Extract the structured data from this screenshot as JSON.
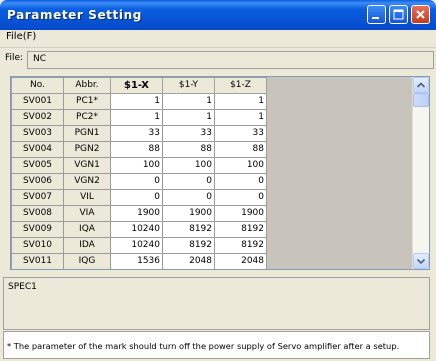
{
  "window": {
    "title": "Parameter Setting"
  },
  "menu": {
    "file_label": "File(F)"
  },
  "file": {
    "label": "File:",
    "value": "NC"
  },
  "grid": {
    "headers": [
      "No.",
      "Abbr.",
      "$1-X",
      "$1-Y",
      "$1-Z"
    ],
    "rows": [
      [
        "SV001",
        "PC1*",
        "1",
        "1",
        "1"
      ],
      [
        "SV002",
        "PC2*",
        "1",
        "1",
        "1"
      ],
      [
        "SV003",
        "PGN1",
        "33",
        "33",
        "33"
      ],
      [
        "SV004",
        "PGN2",
        "88",
        "88",
        "88"
      ],
      [
        "SV005",
        "VGN1",
        "100",
        "100",
        "100"
      ],
      [
        "SV006",
        "VGN2",
        "0",
        "0",
        "0"
      ],
      [
        "SV007",
        "VIL",
        "0",
        "0",
        "0"
      ],
      [
        "SV008",
        "VIA",
        "1900",
        "1900",
        "1900"
      ],
      [
        "SV009",
        "IQA",
        "10240",
        "8192",
        "8192"
      ],
      [
        "SV010",
        "IDA",
        "10240",
        "8192",
        "8192"
      ],
      [
        "SV011",
        "IQG",
        "1536",
        "2048",
        "2048"
      ]
    ]
  },
  "spec": {
    "text": "SPEC1"
  },
  "note": {
    "text": "* The parameter of the mark should turn off the power supply of Servo amplifier after a setup."
  },
  "colors": {
    "titlebar": "#0a5fe0",
    "close_button": "#d8512f",
    "face": "#ece9d8"
  },
  "icons": {
    "minimize": "minimize-icon",
    "maximize": "maximize-icon",
    "close": "close-icon",
    "scroll_up": "chevron-up-icon",
    "scroll_down": "chevron-down-icon"
  }
}
